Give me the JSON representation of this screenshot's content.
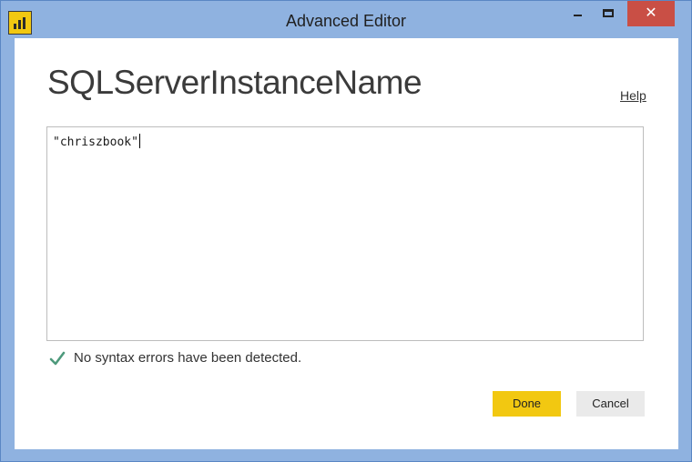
{
  "window": {
    "title": "Advanced Editor",
    "close_glyph": "✕"
  },
  "page": {
    "title": "SQLServerInstanceName",
    "help_label": "Help"
  },
  "editor": {
    "content": "\"chriszbook\""
  },
  "status": {
    "icon": "check-icon",
    "message": "No syntax errors have been detected."
  },
  "actions": {
    "done_label": "Done",
    "cancel_label": "Cancel"
  },
  "colors": {
    "accent": "#f2c811",
    "frame": "#8fb2e0",
    "close": "#c94f45",
    "check": "#4e9a7c"
  }
}
